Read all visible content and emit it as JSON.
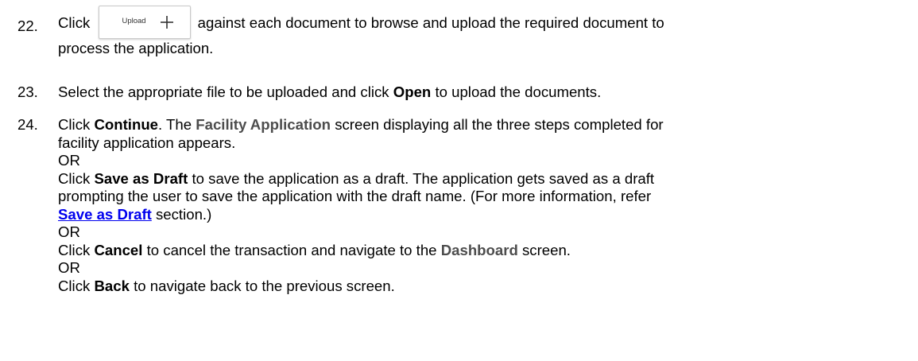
{
  "steps": {
    "s22": {
      "number": "22.",
      "click": "Click",
      "upload_button_label": "Upload",
      "text_a": "against each document to browse and upload the required document to",
      "text_b": "process the application."
    },
    "s23": {
      "number": "23.",
      "pre": "Select the appropriate file to be uploaded and click",
      "open": "Open",
      "post": "to upload the documents."
    },
    "s24": {
      "number": "24.",
      "click": "Click",
      "continue": "Continue",
      "mid1": ". The",
      "facility_application": "Facility Application",
      "post1a": "screen displaying all the three steps completed for",
      "post1b": "facility application appears.",
      "or": "OR",
      "save_as_draft": "Save as Draft",
      "draft_text_a": "to save the application as a draft. The application gets saved as a draft",
      "draft_text_b": "prompting the user to save the application with the draft name. (For more information, refer",
      "draft_link": "Save as Draft",
      "draft_text_c": "section.)",
      "cancel": "Cancel",
      "cancel_text": "to cancel the transaction and navigate to the",
      "dashboard": "Dashboard",
      "screen_word": "screen.",
      "back": "Back",
      "back_text": "to navigate back to the previous screen."
    }
  }
}
